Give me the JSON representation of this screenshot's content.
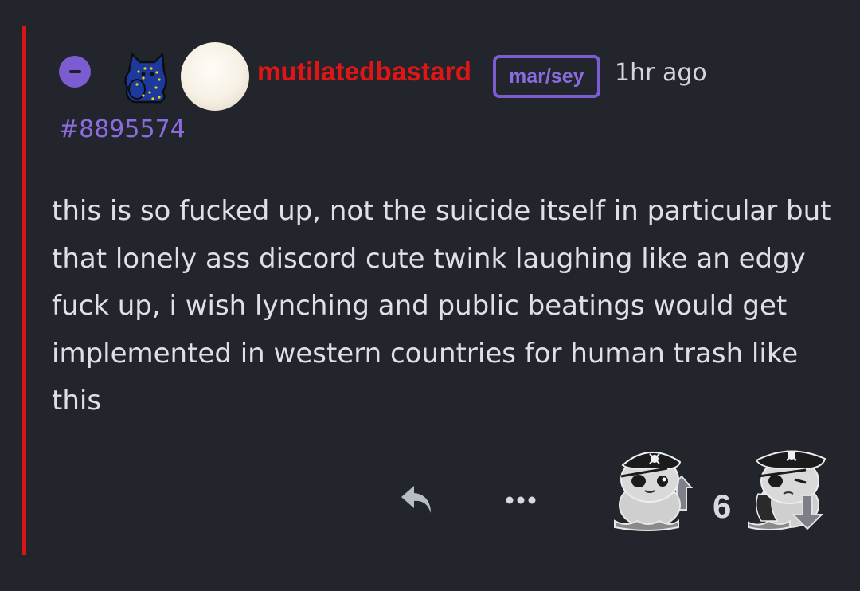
{
  "comment": {
    "username": "mutilatedbastard",
    "pronouns": "mar/sey",
    "timestamp": "1hr ago",
    "post_id": "#8895574",
    "body": "this is so fucked up, not the suicide itself in particular but that lonely ass discord cute twink laughing like an edgy fuck up, i wish lynching and public beatings would get implemented in western countries for human trash like this",
    "score": "6"
  },
  "colors": {
    "background": "#22252b",
    "thread_line": "#d81414",
    "username": "#e01616",
    "accent_purple": "#7b5cd1",
    "text": "#dde0e5"
  },
  "icons": {
    "collapse": "minus-circle-icon",
    "user_badge": "eu-flag-cat-badge-icon",
    "avatar": "avatar",
    "reply": "reply-arrow-icon",
    "more": "ellipsis-icon",
    "upvote": "pirate-cat-upvote-icon",
    "downvote": "pirate-cat-downvote-icon"
  }
}
